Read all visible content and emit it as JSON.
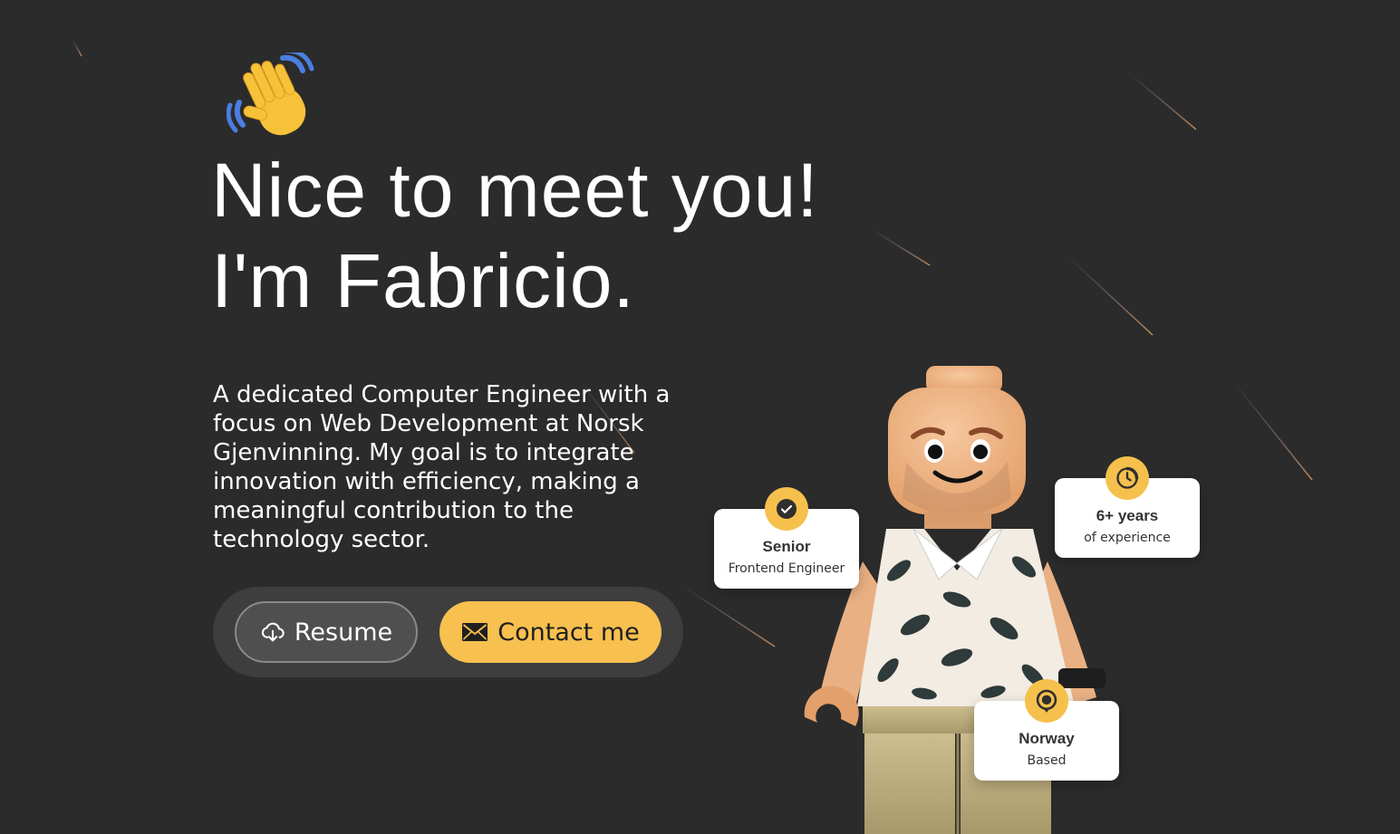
{
  "hero": {
    "greeting_line1": "Nice to meet you!",
    "greeting_line2": "I'm Fabricio.",
    "bio": "A dedicated Computer Engineer with a focus on Web Development at Norsk Gjenvinning. My goal is to integrate innovation with efficiency, making a meaningful contribution to the technology sector."
  },
  "actions": {
    "resume_label": "Resume",
    "contact_label": "Contact me"
  },
  "stats": {
    "senior": {
      "title": "Senior",
      "subtitle": "Frontend Engineer",
      "icon": "check-icon"
    },
    "experience": {
      "title": "6+ years",
      "subtitle": "of experience",
      "icon": "clock-icon"
    },
    "location": {
      "title": "Norway",
      "subtitle": "Based",
      "icon": "location-pin-icon"
    }
  },
  "colors": {
    "background": "#2b2b2b",
    "accent": "#f7c04f",
    "button_secondary": "#4f4f4f"
  },
  "icons": {
    "wave": "waving-hand-icon",
    "resume": "cloud-download-icon",
    "contact": "envelope-icon"
  }
}
